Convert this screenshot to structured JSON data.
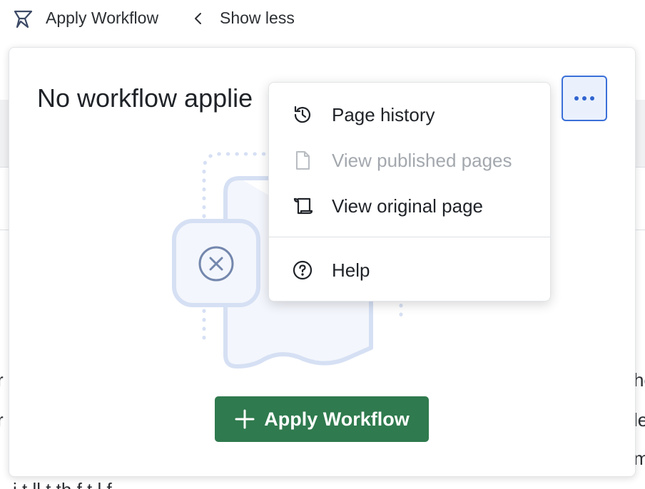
{
  "topbar": {
    "title": "Apply Workflow",
    "show_less_label": "Show less"
  },
  "panel": {
    "title": "No workflow applie",
    "apply_button_label": "Apply Workflow"
  },
  "menu": {
    "items": [
      {
        "label": "Page history",
        "icon": "history-icon",
        "disabled": false
      },
      {
        "label": "View published pages",
        "icon": "document-icon",
        "disabled": true
      },
      {
        "label": "View original page",
        "icon": "scroll-icon",
        "disabled": false
      },
      {
        "label": "Help",
        "icon": "help-icon",
        "disabled": false
      }
    ]
  },
  "background_fragments": {
    "left": [
      "r",
      "r"
    ],
    "right": [
      "he",
      "le",
      "m"
    ],
    "bottom": "i  t  ll        t        th    f                 t      l f"
  },
  "colors": {
    "accent_blue": "#3a6fd8",
    "button_green": "#2f7a4e",
    "illustration_blue": "#d6e0f4",
    "illustration_icon": "#7487ad"
  }
}
